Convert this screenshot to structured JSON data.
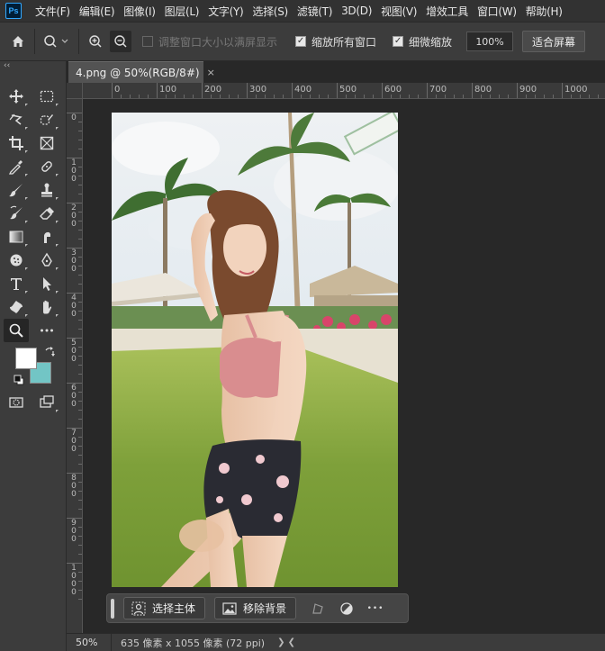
{
  "app": {
    "logo": "Ps"
  },
  "menu": [
    "文件(F)",
    "编辑(E)",
    "图像(I)",
    "图层(L)",
    "文字(Y)",
    "选择(S)",
    "滤镜(T)",
    "3D(D)",
    "视图(V)",
    "增效工具",
    "窗口(W)",
    "帮助(H)"
  ],
  "options": {
    "resize_windows_label": "调整窗口大小以满屏显示",
    "zoom_all_label": "缩放所有窗口",
    "scrubby_zoom_label": "细微缩放",
    "zoom_value": "100%",
    "fit_screen_label": "适合屏幕"
  },
  "toolbar": {
    "collapse_glyph": "‹‹",
    "foreground_color": "#ffffff",
    "background_color": "#72c5c5"
  },
  "document": {
    "tab_title": "4.png @ 50%(RGB/8#)",
    "close_glyph": "×"
  },
  "ruler": {
    "h_labels": [
      "0",
      "100",
      "200",
      "300",
      "400",
      "500",
      "600",
      "700",
      "800",
      "900",
      "1000"
    ],
    "v_labels": [
      "0",
      "1\n0\n0",
      "2\n0\n0",
      "3\n0\n0",
      "4\n0\n0",
      "5\n0\n0",
      "6\n0\n0",
      "7\n0\n0",
      "8\n0\n0",
      "9\n0\n0",
      "1\n0\n0\n0"
    ]
  },
  "taskbar": {
    "select_subject_label": "选择主体",
    "remove_bg_label": "移除背景",
    "more_glyph": "•••"
  },
  "status": {
    "zoom": "50%",
    "doc_info": "635 像素 x 1055 像素 (72 ppi)",
    "nav_glyphs": "❯  ❮"
  }
}
